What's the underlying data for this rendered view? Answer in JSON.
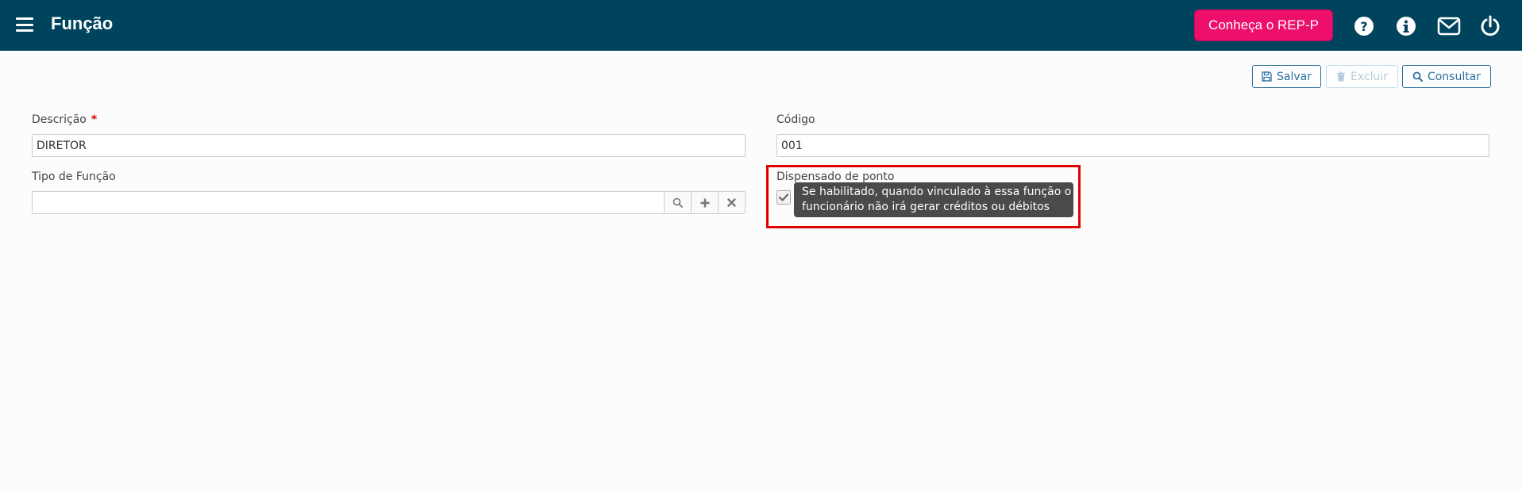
{
  "header": {
    "title": "Função",
    "menu_icon": "hamburger-menu-icon",
    "promo_button_label": "Conheça o REP-P",
    "icons": [
      "help-icon",
      "info-icon",
      "mail-icon",
      "power-icon"
    ]
  },
  "toolbar": {
    "save_label": "Salvar",
    "delete_label": "Excluir",
    "search_label": "Consultar"
  },
  "form": {
    "descricao": {
      "label": "Descrição",
      "required_mark": "*",
      "value": "DIRETOR"
    },
    "codigo": {
      "label": "Código",
      "value": "001"
    },
    "tipo_funcao": {
      "label": "Tipo de Função",
      "value": "",
      "addon_icons": [
        "search-icon",
        "plus-icon",
        "clear-icon"
      ]
    },
    "dispensado": {
      "label": "Dispensado de ponto",
      "checked": true,
      "tooltip_line1": "Se habilitado, quando vinculado à essa função o",
      "tooltip_line2": "funcionário não irá gerar créditos ou débitos"
    }
  },
  "colors": {
    "header_bg": "#00435c",
    "promo_bg": "#ec0f6b",
    "toolbar_accent": "#2b6f9e",
    "highlight": "#e00000",
    "tooltip_bg": "#4a4a4a",
    "required": "#d40000"
  }
}
